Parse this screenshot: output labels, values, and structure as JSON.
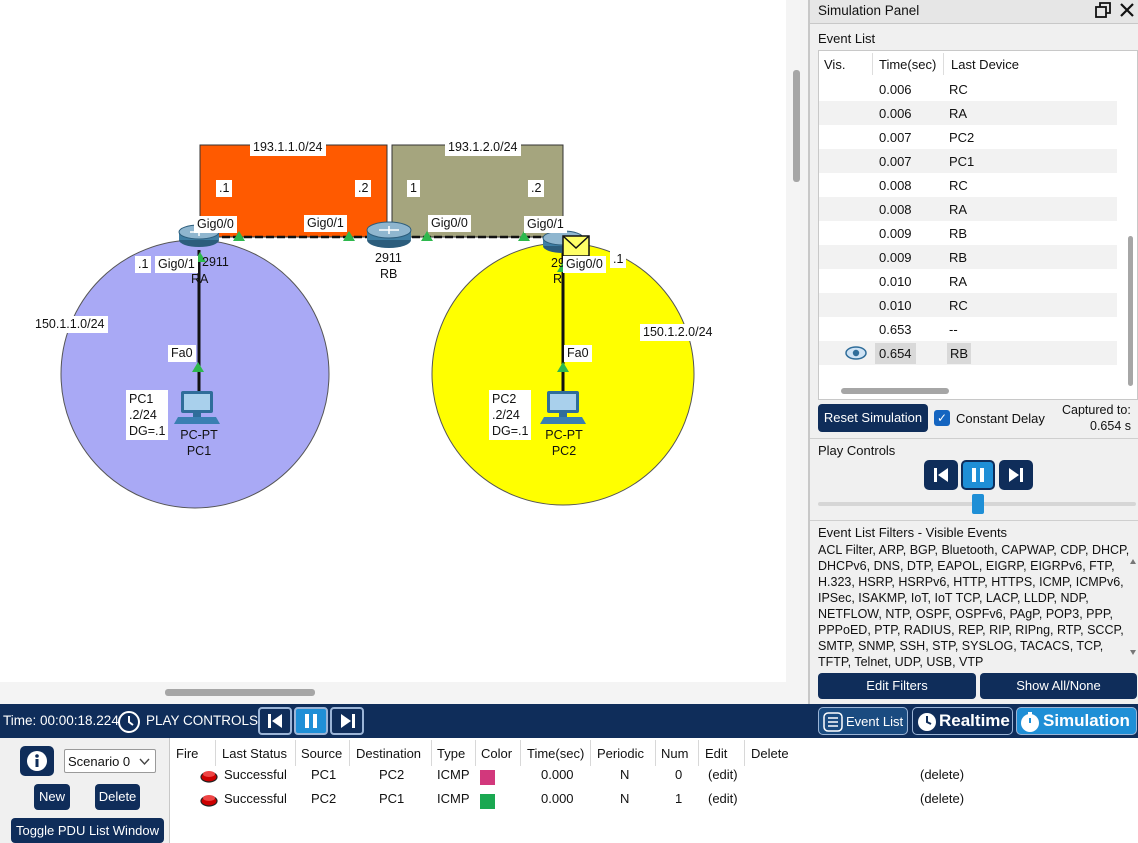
{
  "topology": {
    "networks": {
      "wan1": "193.1.1.0/24",
      "wan2": "193.1.2.0/24",
      "lan1": "150.1.1.0/24",
      "lan2": "150.1.2.0/24"
    },
    "wan1_left": ".1",
    "wan1_right": ".2",
    "wan2_left": "1",
    "wan2_right": ".2",
    "lan1_gw": ".1",
    "lan2_gw": ".1",
    "ports": {
      "ra_gig00": "Gig0/0",
      "ra_gig01": "Gig0/1",
      "rb_gig01": "Gig0/1",
      "rb_gig00": "Gig0/0",
      "rc_gig01": "Gig0/1",
      "rc_gig00": "Gig0/0",
      "pc1_fa0": "Fa0",
      "pc2_fa0": "Fa0"
    },
    "routers": {
      "ra_model": "2911",
      "ra_name": "RA",
      "rb_model": "2911",
      "rb_name": "RB",
      "rc_model": "2911",
      "rc_name": "RC"
    },
    "pcs": {
      "pc1_type": "PC-PT",
      "pc1_name": "PC1",
      "pc1_note_name": "PC1",
      "pc1_note_ip": ".2/24",
      "pc1_note_dg": "DG=.1",
      "pc2_type": "PC-PT",
      "pc2_name": "PC2",
      "pc2_note_name": "PC2",
      "pc2_note_ip": ".2/24",
      "pc2_note_dg": "DG=.1"
    },
    "colors": {
      "wan1": "#ff5a00",
      "wan2": "#a5a57e",
      "lan1": "#a9a9f5",
      "lan2": "#ffff00",
      "link_up": "#2db84d"
    }
  },
  "panel": {
    "title": "Simulation Panel",
    "restore_icon": "restore-window-icon",
    "close_icon": "close-icon",
    "event_list_heading": "Event List",
    "columns": {
      "vis": "Vis.",
      "time": "Time(sec)",
      "device": "Last Device"
    },
    "events": [
      {
        "time": "0.006",
        "device": "RC"
      },
      {
        "time": "0.006",
        "device": "RA"
      },
      {
        "time": "0.007",
        "device": "PC2"
      },
      {
        "time": "0.007",
        "device": "PC1"
      },
      {
        "time": "0.008",
        "device": "RC"
      },
      {
        "time": "0.008",
        "device": "RA"
      },
      {
        "time": "0.009",
        "device": "RB"
      },
      {
        "time": "0.009",
        "device": "RB"
      },
      {
        "time": "0.010",
        "device": "RA"
      },
      {
        "time": "0.010",
        "device": "RC"
      },
      {
        "time": "0.653",
        "device": "--"
      },
      {
        "time": "0.654",
        "device": "RB"
      }
    ],
    "reset_label": "Reset Simulation",
    "constant_delay_label": "Constant Delay",
    "captured_label": "Captured to:",
    "captured_value": "0.654 s",
    "play_controls_heading": "Play Controls",
    "filters_heading": "Event List Filters - Visible Events",
    "filters_text": "ACL Filter, ARP, BGP, Bluetooth, CAPWAP, CDP, DHCP, DHCPv6, DNS, DTP, EAPOL, EIGRP, EIGRPv6, FTP, H.323, HSRP, HSRPv6, HTTP, HTTPS, ICMP, ICMPv6, IPSec, ISAKMP, IoT, IoT TCP, LACP, LLDP, NDP, NETFLOW, NTP, OSPF, OSPFv6, PAgP, POP3, PPP, PPPoED, PTP, RADIUS, REP, RIP, RIPng, RTP, SCCP, SMTP, SNMP, SSH, STP, SYSLOG, TACACS, TCP, TFTP, Telnet, UDP, USB, VTP",
    "edit_filters_label": "Edit Filters",
    "show_all_label": "Show All/None"
  },
  "control_bar": {
    "time_label": "Time: 00:00:18.224",
    "play_controls_label": "PLAY CONTROLS:",
    "event_list_btn": "Event List",
    "realtime_btn": "Realtime",
    "simulation_btn": "Simulation"
  },
  "pdu": {
    "info_icon": "info-icon",
    "scenario": "Scenario 0",
    "new_label": "New",
    "delete_label": "Delete",
    "toggle_label": "Toggle PDU List Window",
    "columns": [
      "Fire",
      "Last Status",
      "Source",
      "Destination",
      "Type",
      "Color",
      "Time(sec)",
      "Periodic",
      "Num",
      "Edit",
      "Delete"
    ],
    "rows": [
      {
        "status": "Successful",
        "source": "PC1",
        "destination": "PC2",
        "type": "ICMP",
        "color": "#d2387c",
        "time": "0.000",
        "periodic": "N",
        "num": "0",
        "edit": "(edit)",
        "delete": "(delete)"
      },
      {
        "status": "Successful",
        "source": "PC2",
        "destination": "PC1",
        "type": "ICMP",
        "color": "#1aa851",
        "time": "0.000",
        "periodic": "N",
        "num": "1",
        "edit": "(edit)",
        "delete": "(delete)"
      }
    ]
  }
}
